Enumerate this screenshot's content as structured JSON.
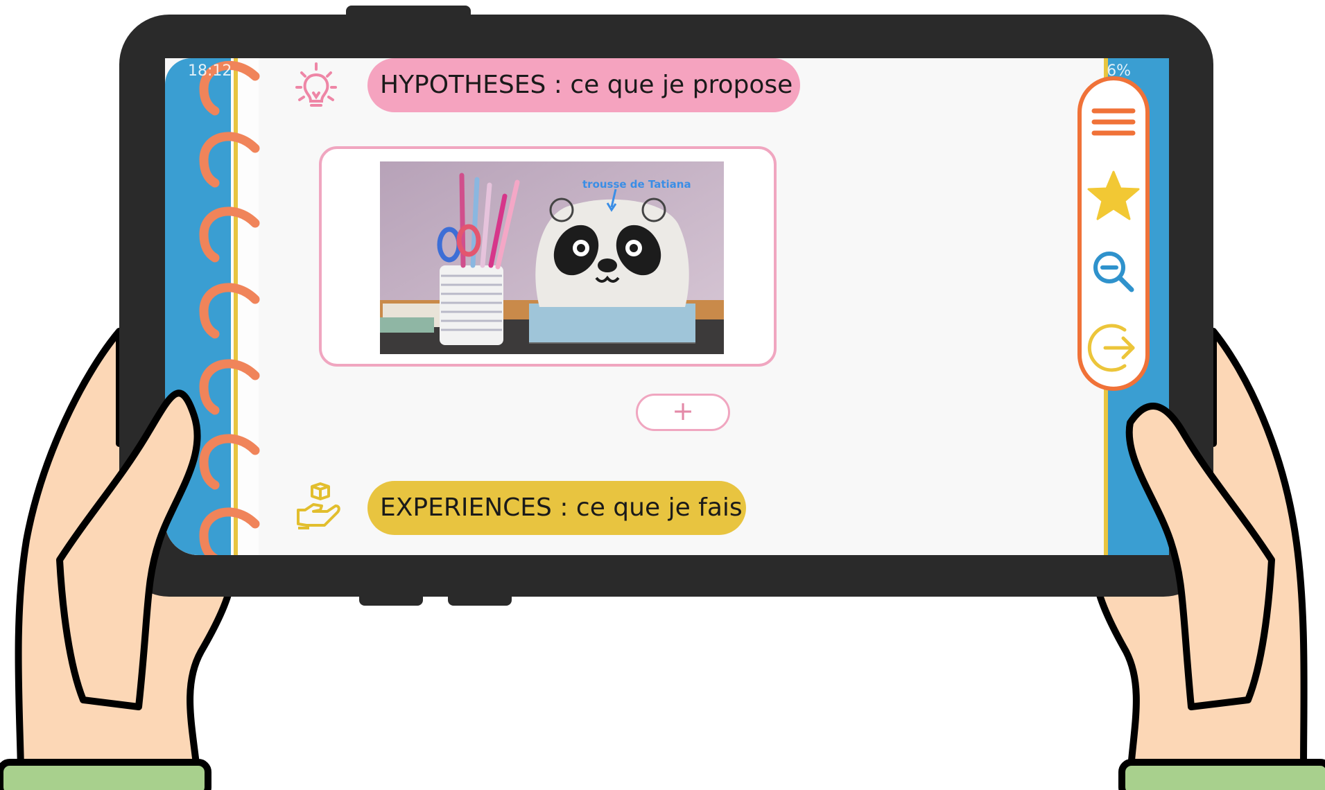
{
  "status_bar": {
    "time": "18:12",
    "battery": "6%"
  },
  "sections": [
    {
      "label": "HYPOTHESES : ce que je propose",
      "icon": "lightbulb-icon",
      "color": "#f5a3bf"
    },
    {
      "label": "EXPERIENCES : ce que je fais",
      "icon": "hand-cube-icon",
      "color": "#e8c440"
    }
  ],
  "photo": {
    "caption": "trousse de Tatiana"
  },
  "add_button": {
    "label": "+"
  },
  "side_menu": {
    "items": [
      {
        "icon": "hamburger-menu-icon"
      },
      {
        "icon": "star-icon"
      },
      {
        "icon": "zoom-out-icon"
      },
      {
        "icon": "exit-arrow-icon"
      }
    ]
  },
  "colors": {
    "notebook_blue": "#3a9ed2",
    "ring_orange": "#f0845a",
    "menu_border": "#f07238",
    "hypotheses_pink": "#f5a3bf",
    "experiences_yellow": "#e8c440",
    "skin": "#fcd7b6",
    "sleeve": "#a8d08d"
  }
}
